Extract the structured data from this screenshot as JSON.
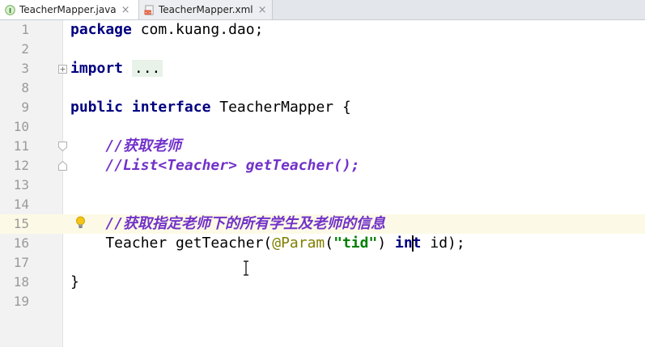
{
  "tabs": [
    {
      "label": "TeacherMapper.java",
      "close": "×",
      "active": true
    },
    {
      "label": "TeacherMapper.xml",
      "close": "×",
      "active": false
    }
  ],
  "editor": {
    "current_line": "15",
    "lines": [
      {
        "num": "1",
        "tokens": [
          {
            "t": "package",
            "c": "kw"
          },
          {
            "t": " com.kuang.dao;",
            "c": "plain"
          }
        ]
      },
      {
        "num": "2",
        "tokens": []
      },
      {
        "num": "3",
        "tokens": [
          {
            "t": "import",
            "c": "kw"
          },
          {
            "t": " ",
            "c": "plain"
          },
          {
            "t": "...",
            "c": "fold-text"
          }
        ]
      },
      {
        "num": "8",
        "tokens": []
      },
      {
        "num": "9",
        "tokens": [
          {
            "t": "public",
            "c": "kw"
          },
          {
            "t": " ",
            "c": "plain"
          },
          {
            "t": "interface",
            "c": "kw"
          },
          {
            "t": " TeacherMapper {",
            "c": "plain"
          }
        ]
      },
      {
        "num": "10",
        "tokens": []
      },
      {
        "num": "11",
        "tokens": [
          {
            "t": "    ",
            "c": "plain"
          },
          {
            "t": "//获取老师",
            "c": "cmt"
          }
        ]
      },
      {
        "num": "12",
        "tokens": [
          {
            "t": "    ",
            "c": "plain"
          },
          {
            "t": "//List<Teacher> getTeacher();",
            "c": "cmt"
          }
        ]
      },
      {
        "num": "13",
        "tokens": []
      },
      {
        "num": "14",
        "tokens": []
      },
      {
        "num": "15",
        "tokens": [
          {
            "t": "    ",
            "c": "plain"
          },
          {
            "t": "//获取指定老师下的所有学生及老师的信息",
            "c": "cmt"
          }
        ]
      },
      {
        "num": "16",
        "tokens": [
          {
            "t": "    Teacher getTeacher(",
            "c": "plain"
          },
          {
            "t": "@Param",
            "c": "ann"
          },
          {
            "t": "(",
            "c": "plain"
          },
          {
            "t": "\"tid\"",
            "c": "str"
          },
          {
            "t": ") ",
            "c": "plain"
          },
          {
            "t": "int",
            "c": "kw"
          },
          {
            "t": " id);",
            "c": "plain"
          }
        ]
      },
      {
        "num": "17",
        "tokens": []
      },
      {
        "num": "18",
        "tokens": [
          {
            "t": "}",
            "c": "plain"
          }
        ]
      },
      {
        "num": "19",
        "tokens": []
      }
    ]
  },
  "icons": {
    "java_file": "java-interface-icon",
    "xml_file": "mybatis-xml-icon",
    "fold_expand": "fold-expand-icon",
    "fold_start": "fold-start-icon",
    "fold_end": "fold-end-icon",
    "intention": "lightbulb-icon"
  },
  "colors": {
    "keyword": "#000080",
    "comment": "#7131c9",
    "annotation": "#808000",
    "string": "#008000",
    "current_line_bg": "#fcfae6"
  }
}
